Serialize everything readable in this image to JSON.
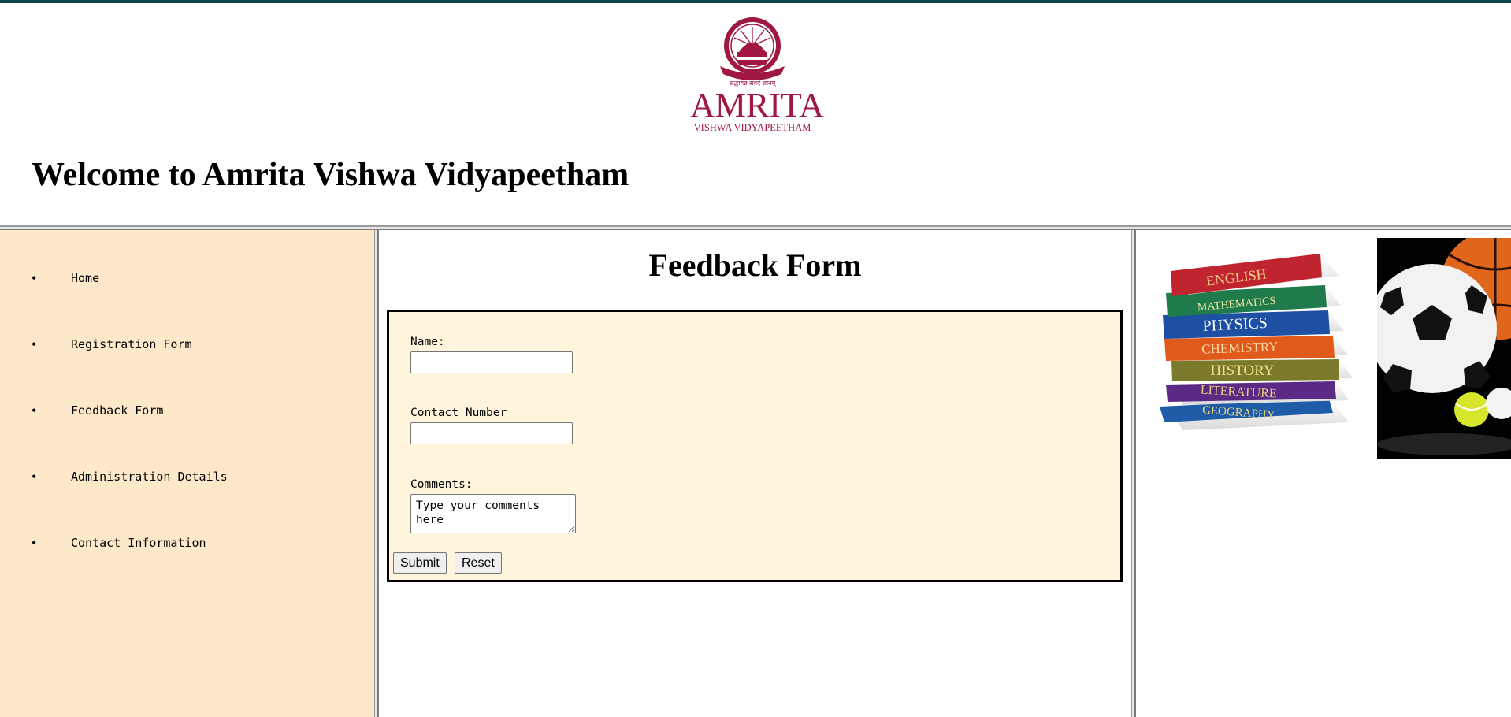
{
  "header": {
    "logo_word": "AMRITA",
    "logo_subtitle": "VISHWA VIDYAPEETHAM",
    "logo_motto": "सद्धावन्न सर्वदे ज्ञानम्",
    "welcome_title": "Welcome to Amrita Vishwa Vidyapeetham",
    "accent_color": "#0c4a4a",
    "logo_color": "#a0173f"
  },
  "sidebar": {
    "background": "#fde8c9",
    "items": [
      {
        "label": "Home"
      },
      {
        "label": "Registration Form"
      },
      {
        "label": "Feedback Form"
      },
      {
        "label": "Administration Details"
      },
      {
        "label": "Contact Information"
      }
    ]
  },
  "main": {
    "title": "Feedback Form",
    "form": {
      "background": "#fff5dc",
      "name_label": "Name:",
      "name_value": "",
      "contact_label": "Contact Number",
      "contact_value": "",
      "comments_label": "Comments:",
      "comments_value": "Type your comments here",
      "submit_label": "Submit",
      "reset_label": "Reset"
    }
  },
  "right_panel": {
    "books_image": {
      "titles": [
        "ENGLISH",
        "MATHEMATICS",
        "PHYSICS",
        "CHEMISTRY",
        "HISTORY",
        "LITERATURE",
        "GEOGRAPHY"
      ]
    },
    "sports_image": "sports-balls-image"
  }
}
